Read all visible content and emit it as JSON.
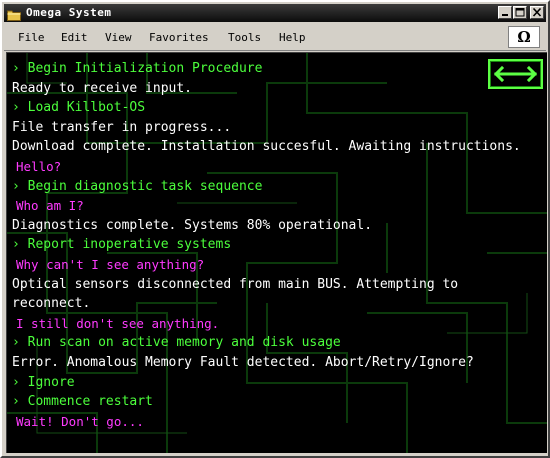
{
  "window": {
    "title": "Omega System",
    "title_icon": "folder-icon",
    "controls": {
      "minimize": "minimize-icon",
      "maximize": "maximize-icon",
      "close": "close-icon"
    }
  },
  "menubar": {
    "items": [
      "File",
      "Edit",
      "View",
      "Favorites",
      "Tools",
      "Help"
    ],
    "omega_button": "Ω"
  },
  "terminal": {
    "nav_button_icon": "swap-arrows-icon",
    "lines": [
      {
        "kind": "cmd",
        "text": "› Begin Initialization Procedure"
      },
      {
        "kind": "out",
        "text": "Ready to receive input."
      },
      {
        "kind": "cmd",
        "text": "› Load Killbot-OS"
      },
      {
        "kind": "out",
        "text": "File transfer in progress..."
      },
      {
        "kind": "out",
        "text": "Download complete. Installation succesful. Awaiting instructions."
      },
      {
        "kind": "user",
        "text": "Hello?"
      },
      {
        "kind": "cmd",
        "text": "› Begin diagnostic task sequence"
      },
      {
        "kind": "user",
        "text": "Who am I?"
      },
      {
        "kind": "out",
        "text": "Diagnostics complete. Systems 80% operational."
      },
      {
        "kind": "cmd",
        "text": "› Report inoperative systems"
      },
      {
        "kind": "user",
        "text": "Why can't I see anything?"
      },
      {
        "kind": "out",
        "text": "Optical sensors disconnected from main BUS. Attempting to reconnect."
      },
      {
        "kind": "user",
        "text": "I still don't see anything."
      },
      {
        "kind": "cmd",
        "text": "› Run scan on active memory and disk usage"
      },
      {
        "kind": "out",
        "text": "Error. Anomalous Memory Fault detected. Abort/Retry/Ignore?"
      },
      {
        "kind": "cmd",
        "text": "› Ignore"
      },
      {
        "kind": "cmd",
        "text": "› Commence restart"
      },
      {
        "kind": "user",
        "text": "Wait! Don't go..."
      }
    ]
  },
  "colors": {
    "command": "#4cff3c",
    "output": "#ffffff",
    "user": "#ff3bff",
    "background": "#000000",
    "grid": "#0b3a0b"
  }
}
